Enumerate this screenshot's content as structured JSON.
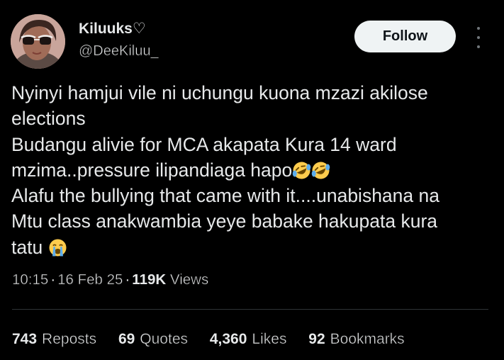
{
  "author": {
    "display_name": "Kiluuks",
    "badge": "♡",
    "handle": "@DeeKiluu_",
    "avatar": "profile-photo"
  },
  "header": {
    "follow_label": "Follow",
    "more_icon": "more-vertical-icon"
  },
  "tweet": {
    "lines": [
      {
        "text": "Nyinyi hamjui vile ni uchungu kuona mzazi akilose"
      },
      {
        "text": "elections"
      },
      {
        "text": "Budangu alivie for MCA akapata Kura 14 ward"
      },
      {
        "text": "mzima..pressure ilipandiaga hapo",
        "emoji": [
          "rolling-on-floor-laughing",
          "rolling-on-floor-laughing"
        ]
      },
      {
        "text": "Alafu the bullying that came with it....unabishana na"
      },
      {
        "text": "Mtu class anakwambia yeye babake hakupata kura"
      },
      {
        "text": "tatu ",
        "emoji": [
          "loudly-crying-face"
        ]
      }
    ]
  },
  "meta": {
    "time": "10:15",
    "date": "16 Feb 25",
    "views_count": "119K",
    "views_label": "Views",
    "separator": "·"
  },
  "stats": [
    {
      "count": "743",
      "label": "Reposts"
    },
    {
      "count": "69",
      "label": "Quotes"
    },
    {
      "count": "4,360",
      "label": "Likes"
    },
    {
      "count": "92",
      "label": "Bookmarks"
    }
  ],
  "colors": {
    "background": "#000000",
    "text": "#e7e9ea",
    "secondary": "#71767b",
    "divider": "#2f3336",
    "follow_bg": "#eff3f4",
    "follow_text": "#0f1419"
  }
}
